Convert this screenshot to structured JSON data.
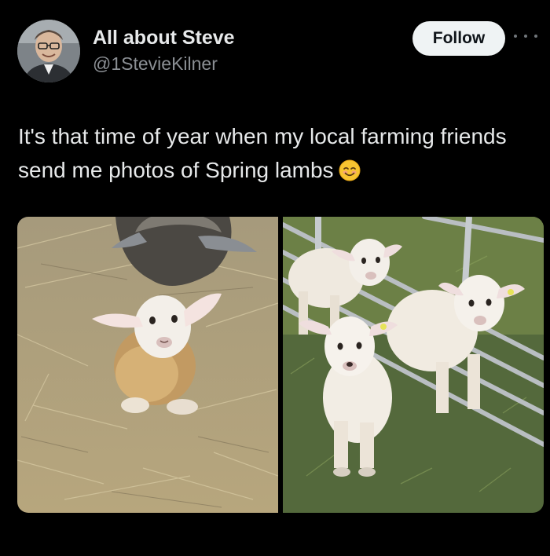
{
  "post": {
    "author": {
      "display_name": "All about Steve",
      "handle": "@1StevieKilner",
      "avatar": "profile-photo"
    },
    "follow_label": "Follow",
    "more_icon": "more-options-icon",
    "text": "It's that time of year when my local farming friends send me photos of Spring lambs",
    "text_emoji": "smiling-face-emoji",
    "media": [
      {
        "icon": "photo-lamb-on-straw"
      },
      {
        "icon": "photo-three-lambs-on-grass"
      }
    ]
  },
  "colors": {
    "background": "#000000",
    "primary_text": "#e7e9ea",
    "secondary_text": "#8b8f94",
    "follow_button_bg": "#eff3f4",
    "follow_button_text": "#0f1419"
  }
}
